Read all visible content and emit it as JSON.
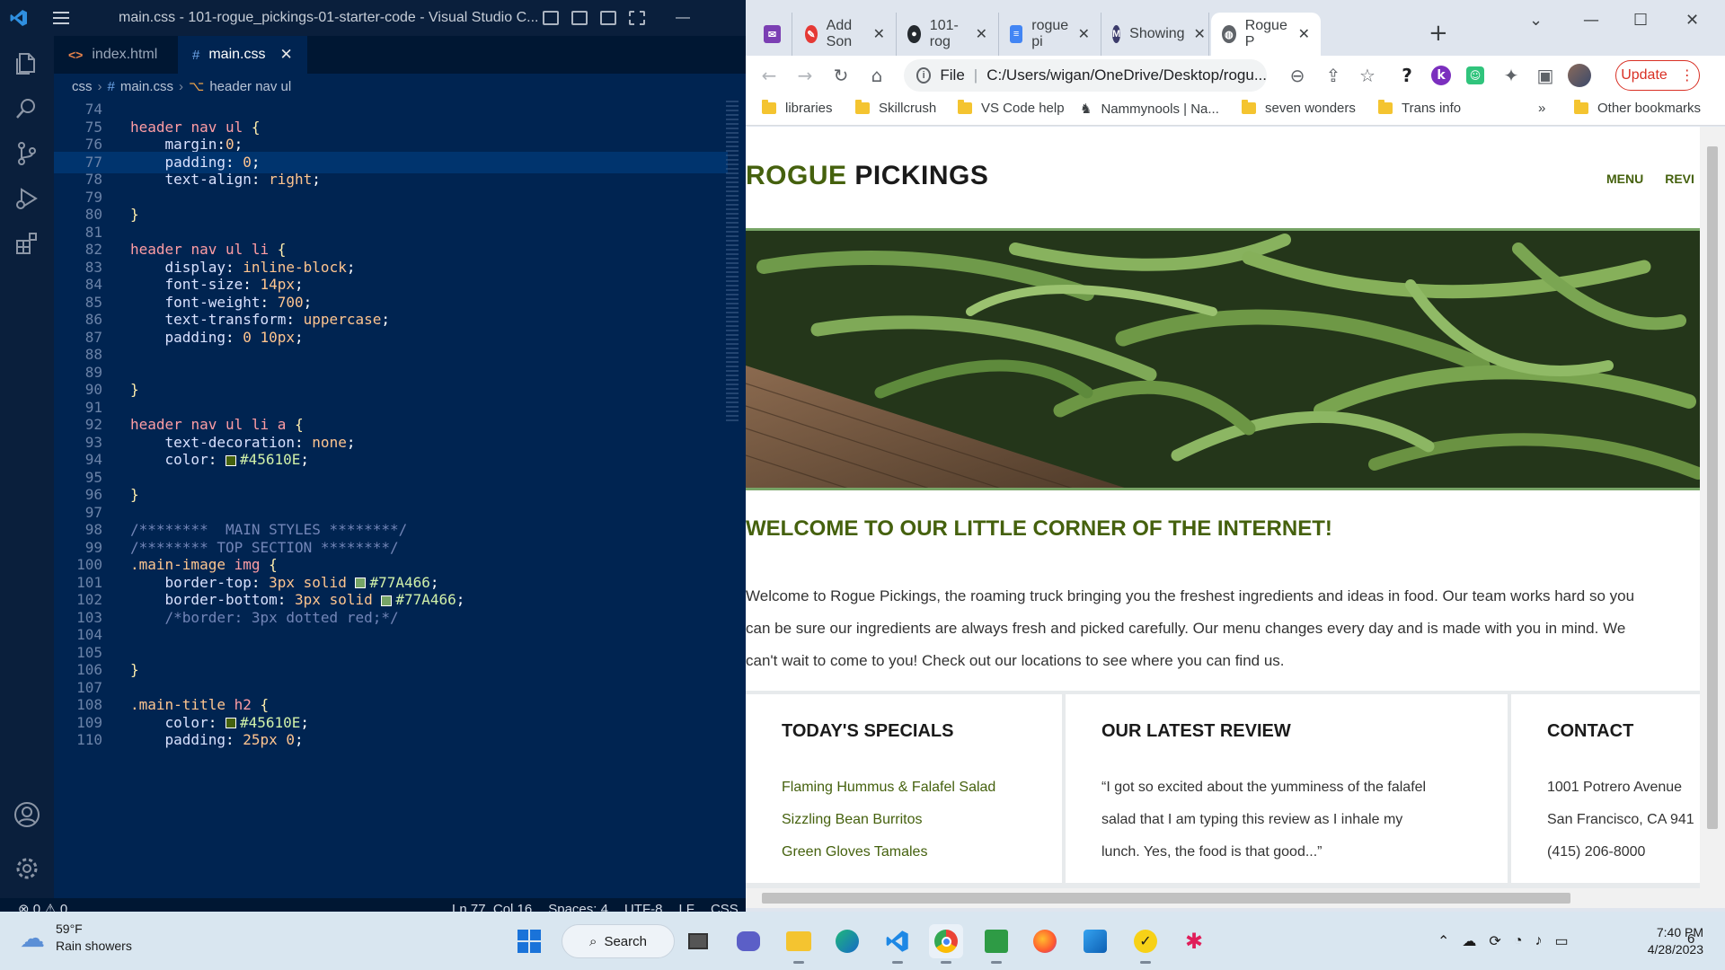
{
  "vscode": {
    "window_title": "main.css - 101-rogue_pickings-01-starter-code - Visual Studio C...",
    "tabs": [
      {
        "label": "index.html"
      },
      {
        "label": "main.css"
      }
    ],
    "breadcrumb": [
      "css",
      "main.css",
      "header nav ul"
    ],
    "code_lines": [
      {
        "n": "74",
        "t": ""
      },
      {
        "n": "75",
        "t": "header nav ul {"
      },
      {
        "n": "76",
        "t": "    margin:0;"
      },
      {
        "n": "77",
        "t": "    padding: 0;"
      },
      {
        "n": "78",
        "t": "    text-align: right;"
      },
      {
        "n": "79",
        "t": ""
      },
      {
        "n": "80",
        "t": "}"
      },
      {
        "n": "81",
        "t": ""
      },
      {
        "n": "82",
        "t": "header nav ul li {"
      },
      {
        "n": "83",
        "t": "    display: inline-block;"
      },
      {
        "n": "84",
        "t": "    font-size: 14px;"
      },
      {
        "n": "85",
        "t": "    font-weight: 700;"
      },
      {
        "n": "86",
        "t": "    text-transform: uppercase;"
      },
      {
        "n": "87",
        "t": "    padding: 0 10px;"
      },
      {
        "n": "88",
        "t": ""
      },
      {
        "n": "89",
        "t": ""
      },
      {
        "n": "90",
        "t": "}"
      },
      {
        "n": "91",
        "t": ""
      },
      {
        "n": "92",
        "t": "header nav ul li a {"
      },
      {
        "n": "93",
        "t": "    text-decoration: none;"
      },
      {
        "n": "94",
        "t": "    color: #45610E;"
      },
      {
        "n": "95",
        "t": ""
      },
      {
        "n": "96",
        "t": "}"
      },
      {
        "n": "97",
        "t": ""
      },
      {
        "n": "98",
        "t": "/********  MAIN STYLES ********/"
      },
      {
        "n": "99",
        "t": "/******** TOP SECTION ********/"
      },
      {
        "n": "100",
        "t": ".main-image img {"
      },
      {
        "n": "101",
        "t": "    border-top: 3px solid #77A466;"
      },
      {
        "n": "102",
        "t": "    border-bottom: 3px solid #77A466;"
      },
      {
        "n": "103",
        "t": "    /*border: 3px dotted red;*/"
      },
      {
        "n": "104",
        "t": ""
      },
      {
        "n": "105",
        "t": ""
      },
      {
        "n": "106",
        "t": "}"
      },
      {
        "n": "107",
        "t": ""
      },
      {
        "n": "108",
        "t": ".main-title h2 {"
      },
      {
        "n": "109",
        "t": "    color: #45610E;"
      },
      {
        "n": "110",
        "t": "    padding: 25px 0;"
      }
    ],
    "status": {
      "errors": "0",
      "warnings": "0",
      "position": "Ln 77, Col 16",
      "spaces": "Spaces: 4",
      "encoding": "UTF-8",
      "eol": "LF",
      "language": "CSS"
    }
  },
  "chrome": {
    "tabs": [
      {
        "label": "Add Son"
      },
      {
        "label": "101-rog"
      },
      {
        "label": "rogue pi"
      },
      {
        "label": "Showing"
      },
      {
        "label": "Rogue P"
      }
    ],
    "address_scheme": "File",
    "address": "C:/Users/wigan/OneDrive/Desktop/rogu...",
    "update_label": "Update",
    "bookmarks": [
      "libraries",
      "Skillcrush",
      "VS Code help",
      "Nammynools | Na...",
      "seven wonders",
      "Trans info"
    ],
    "other_bookmarks": "Other bookmarks",
    "more": "»"
  },
  "site": {
    "logo_accent": "ROGUE",
    "logo_rest": "PICKINGS",
    "nav": [
      "MENU",
      "REVI"
    ],
    "main_title": "WELCOME TO OUR LITTLE CORNER OF THE INTERNET!",
    "intro_lines": [
      "Welcome to Rogue Pickings, the roaming truck bringing you the freshest ingredients and ideas in food. Our team works hard so you",
      "can be sure our ingredients are always fresh and picked carefully. Our menu changes every day and is made with you in mind. We",
      "can't wait to come to you! Check out our locations to see where you can find us."
    ],
    "cards": [
      {
        "title": "TODAY'S SPECIALS",
        "lines": [
          "Flaming Hummus & Falafel Salad",
          "Sizzling Bean Burritos",
          "Green Gloves Tamales"
        ]
      },
      {
        "title": "OUR LATEST REVIEW",
        "lines": [
          "“I got so excited about the yumminess of the falafel",
          "salad that I am typing this review as I inhale my",
          "lunch. Yes, the food is that good...”"
        ]
      },
      {
        "title": "CONTACT",
        "lines": [
          "1001 Potrero Avenue",
          "San Francisco, CA 941",
          "(415) 206-8000"
        ]
      }
    ]
  },
  "taskbar": {
    "temp": "59°F",
    "weather": "Rain showers",
    "search": "Search",
    "time": "7:40 PM",
    "date": "4/28/2023",
    "notifications": "6"
  },
  "colors": {
    "brand_green": "#45610E",
    "border_green": "#77A466",
    "vscode_bg": "#002451"
  }
}
